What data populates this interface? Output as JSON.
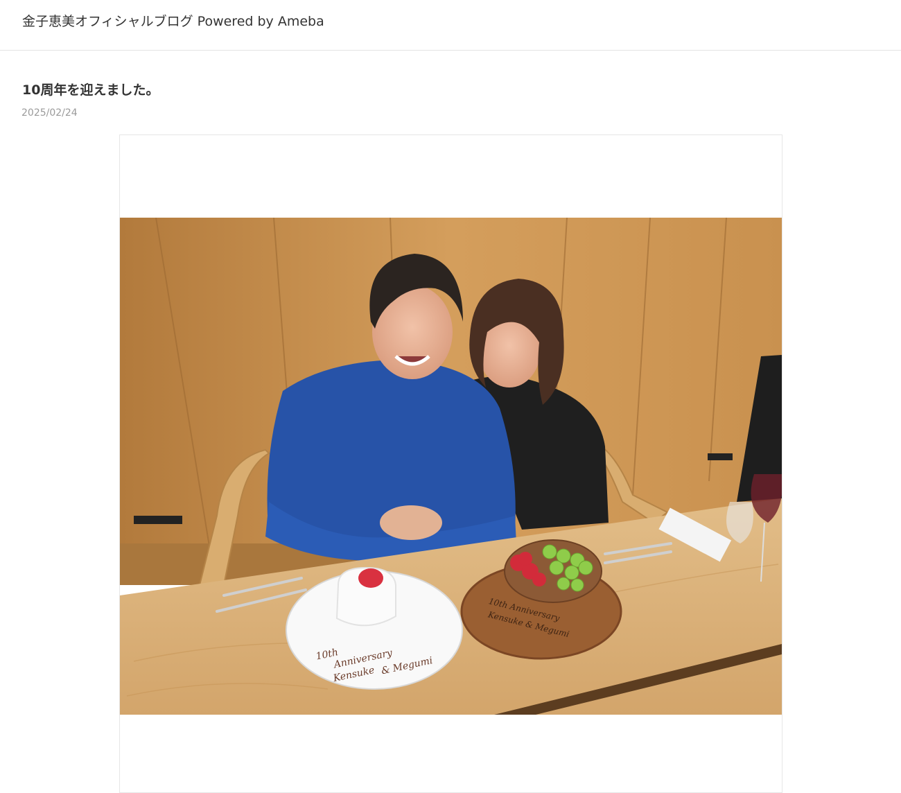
{
  "header": {
    "blog_title": "金子恵美オフィシャルブログ Powered by Ameba"
  },
  "entry": {
    "title": "10周年を迎えました。",
    "date": "2025/02/24",
    "photo": {
      "plate_text_line1": "10th",
      "plate_text_line2": "Anniversary",
      "plate_text_line3": "Kensuke",
      "plate_text_line4": "& Megumi",
      "board_text_line1": "10th Anniversary",
      "board_text_line2": "Kensuke & Megumi"
    }
  },
  "colors": {
    "wall": "#c8924f",
    "table": "#dcb47e",
    "sweater_blue": "#2753a8",
    "sweater_black": "#1f1f1f"
  }
}
